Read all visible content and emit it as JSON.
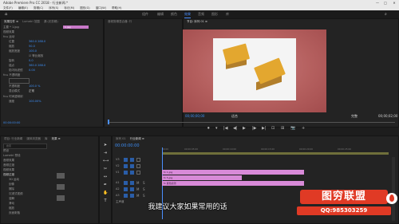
{
  "title": "Adobe Premiere Pro CC 2018 - 行业新闻.* ",
  "window_controls": {
    "minimize": "—",
    "maximize": "□",
    "close": "✕"
  },
  "menu": [
    "文件(F)",
    "编辑(E)",
    "剪辑(C)",
    "序列(S)",
    "标记(M)",
    "图形(G)",
    "窗口(W)",
    "帮助(H)"
  ],
  "workspace_tabs": [
    "组件",
    "编辑",
    "颜色",
    "效果",
    "音频",
    "图形",
    "库"
  ],
  "workspace_active": "效果",
  "effects_panel": {
    "tabs": [
      "效果控件 ≡",
      "Lumetri 范围",
      "源:(无剪辑)",
      "音频剪辑混合器: 行"
    ],
    "source_label": "主要 * 1.jpg",
    "clip_label": "1.jpg",
    "rows": [
      {
        "label": "视频效果"
      },
      {
        "label": "fx ▸ 运动"
      },
      {
        "label": "位置",
        "value": "360.0 288.0"
      },
      {
        "label": "缩放",
        "value": "50.0"
      },
      {
        "label": "缩放宽度",
        "value": "100.0"
      },
      {
        "label": "☑ 等比缩放"
      },
      {
        "label": "旋转",
        "value": "0.0"
      },
      {
        "label": "锚点",
        "value": "360.0 288.0"
      },
      {
        "label": "防闪烁滤镜",
        "value": "0.00"
      },
      {
        "label": "fx ▸ 不透明度"
      },
      {
        "label": "不透明度",
        "value": "100.0 %"
      },
      {
        "label": "混合模式",
        "value": "正常"
      },
      {
        "label": "fx ▸ 时间重映射"
      },
      {
        "label": "速度",
        "value": "100.00%"
      }
    ],
    "timecode": "00:00:00:00"
  },
  "program_monitor": {
    "tab": "节目: 序列 01 ≡",
    "timecode_left": "00;00;00;00",
    "fit": "适合",
    "quality": "完整",
    "timecode_right": "00;00;02;00",
    "controls": [
      "⏺",
      "▾",
      "|◀",
      "◀|",
      "▶",
      "|▶",
      "▶|",
      "⊡",
      "⊞",
      "📷",
      "+"
    ]
  },
  "project_panel": {
    "tabs": [
      "项目: 行业新闻",
      "媒体浏览器",
      "库",
      "信息",
      "效果 ≡",
      "标记",
      "历史记录"
    ],
    "search_placeholder": "搜索",
    "items": [
      "预设",
      "Lumetri 预设",
      "音频效果",
      "音频过渡",
      "视频效果",
      "视频过渡",
      "3D 运动",
      "划像",
      "擦除",
      "沉浸式视频",
      "溶解",
      "滑动",
      "缩放",
      "页面剥落"
    ]
  },
  "timeline": {
    "tabs": [
      "序列 01",
      "行业新闻 ≡"
    ],
    "timecode": "00:00:00:00",
    "ruler": [
      "00:00",
      "00:00:05:00",
      "00:00:10:00",
      "00:00:15:00",
      "00:00:20:00",
      "00:00:25:00",
      "00:00:30:00"
    ],
    "tracks": [
      "V3",
      "V2",
      "V1",
      "A1",
      "A2",
      "A3",
      "主声道"
    ],
    "clips": [
      {
        "label": "fx 1.jpg",
        "color": "#d88ad8"
      },
      {
        "label": "fx 5.jpg",
        "color": "#d88ad8"
      },
      {
        "label": "fx 颜色遮罩",
        "color": "#d88ad8"
      }
    ]
  },
  "subtitle": "我建议大家如果常用的话",
  "watermark": {
    "line1": "图穷联盟",
    "line2": "QQ:985303259"
  },
  "colors": {
    "accent": "#4b8fff",
    "clip": "#d88ad8",
    "logo": "#e03a25"
  }
}
